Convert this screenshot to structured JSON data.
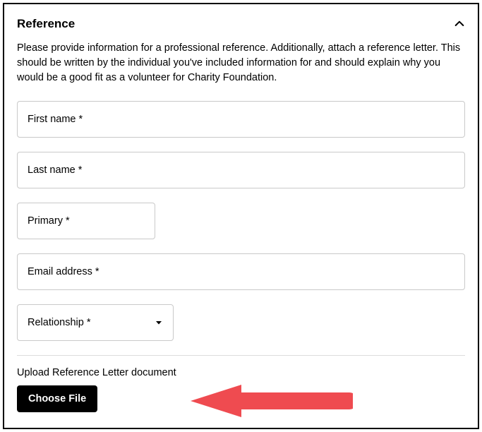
{
  "section": {
    "title": "Reference",
    "description": "Please provide information for a professional reference. Additionally, attach a reference letter. This should be written by the individual you've included information for and should explain why you would be a good fit as a volunteer for Charity Foundation."
  },
  "fields": {
    "first_name": {
      "label": "First name",
      "required": "*"
    },
    "last_name": {
      "label": "Last name",
      "required": "*"
    },
    "primary": {
      "label": "Primary",
      "required": "*"
    },
    "email": {
      "label": "Email address",
      "required": "*"
    },
    "relationship": {
      "label": "Relationship",
      "required": "*"
    }
  },
  "upload": {
    "label": "Upload Reference Letter document",
    "button": "Choose File"
  }
}
